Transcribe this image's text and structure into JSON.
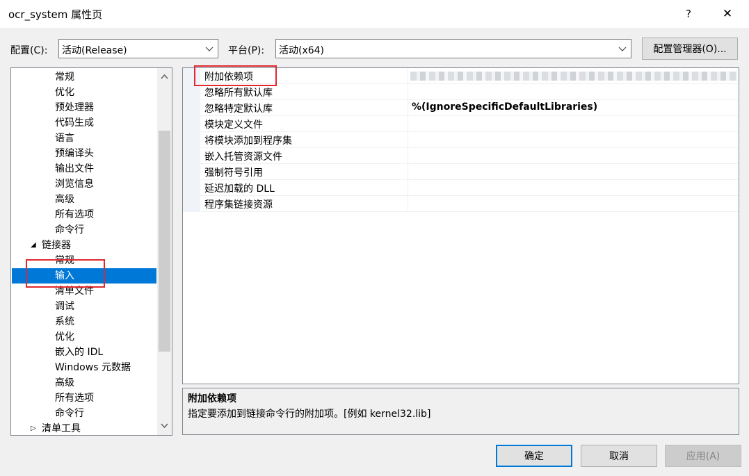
{
  "window": {
    "title": "ocr_system 属性页",
    "help": "?",
    "close": "✕"
  },
  "config": {
    "label": "配置(C):",
    "value": "活动(Release)",
    "platform_label": "平台(P):",
    "platform_value": "活动(x64)",
    "manager_button": "配置管理器(O)..."
  },
  "tree": {
    "items": [
      {
        "label": "常规"
      },
      {
        "label": "优化"
      },
      {
        "label": "预处理器"
      },
      {
        "label": "代码生成"
      },
      {
        "label": "语言"
      },
      {
        "label": "预编译头"
      },
      {
        "label": "输出文件"
      },
      {
        "label": "浏览信息"
      },
      {
        "label": "高级"
      },
      {
        "label": "所有选项"
      },
      {
        "label": "命令行"
      },
      {
        "label": "链接器",
        "expander": "◢"
      },
      {
        "label": "常规"
      },
      {
        "label": "输入"
      },
      {
        "label": "清单文件"
      },
      {
        "label": "调试"
      },
      {
        "label": "系统"
      },
      {
        "label": "优化"
      },
      {
        "label": "嵌入的 IDL"
      },
      {
        "label": "Windows 元数据"
      },
      {
        "label": "高级"
      },
      {
        "label": "所有选项"
      },
      {
        "label": "命令行"
      },
      {
        "label": "清单工具",
        "expander": "▷"
      }
    ]
  },
  "properties": {
    "rows": [
      {
        "name": "附加依赖项",
        "value": ""
      },
      {
        "name": "忽略所有默认库",
        "value": ""
      },
      {
        "name": "忽略特定默认库",
        "value": "%(IgnoreSpecificDefaultLibraries)"
      },
      {
        "name": "模块定义文件",
        "value": ""
      },
      {
        "name": "将模块添加到程序集",
        "value": ""
      },
      {
        "name": "嵌入托管资源文件",
        "value": ""
      },
      {
        "name": "强制符号引用",
        "value": ""
      },
      {
        "name": "延迟加载的 DLL",
        "value": ""
      },
      {
        "name": "程序集链接资源",
        "value": ""
      }
    ]
  },
  "description": {
    "title": "附加依赖项",
    "text": "指定要添加到链接命令行的附加项。[例如 kernel32.lib]"
  },
  "buttons": {
    "ok": "确定",
    "cancel": "取消",
    "apply": "应用(A)"
  }
}
